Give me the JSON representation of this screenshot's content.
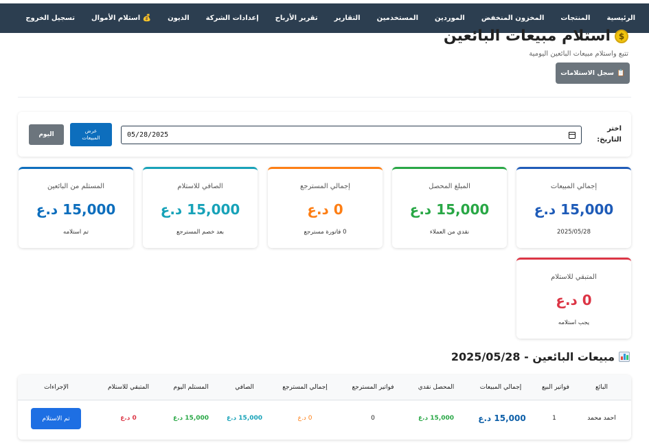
{
  "nav": {
    "items": [
      "الرئيسية",
      "المنتجات",
      "المخزون المنخفض",
      "الموردين",
      "المستخدمين",
      "التقارير",
      "تقرير الأرباح",
      "إعدادات الشركة",
      "الديون",
      "💰 استلام الأموال",
      "تسجيل الخروج"
    ]
  },
  "header": {
    "title": "استلام مبيعات البائعين",
    "subtitle": "تتبع واستلام مبيعات البائعين اليومية",
    "log_button": "سجل الاستلامات"
  },
  "filter": {
    "label_line1": "اختر",
    "label_line2": "التاريخ:",
    "date_value": "05/28/2025",
    "show_button_line1": "عرض",
    "show_button_line2": "المبيعات",
    "today_button": "اليوم"
  },
  "stats": [
    {
      "label": "إجمالي المبيعات",
      "value": "15,000 د.ع",
      "sub": "2025/05/28",
      "color": "#1e5bb8"
    },
    {
      "label": "المبلغ المحصل",
      "value": "15,000 د.ع",
      "sub": "نقدي من العملاء",
      "color": "#28a745"
    },
    {
      "label": "إجمالي المسترجع",
      "value": "0 د.ع",
      "sub": "0 فاتورة مسترجع",
      "color": "#fd7e14"
    },
    {
      "label": "الصافي للاستلام",
      "value": "15,000 د.ع",
      "sub": "بعد خصم المسترجع",
      "color": "#17a2b8"
    },
    {
      "label": "المستلم من البائعين",
      "value": "15,000 د.ع",
      "sub": "تم استلامه",
      "color": "#0d6ebd"
    },
    {
      "label": "المتبقي للاستلام",
      "value": "0 د.ع",
      "sub": "يجب استلامه",
      "color": "#dc3545"
    }
  ],
  "section": {
    "title": "مبيعات البائعين - 2025/05/28"
  },
  "table": {
    "headers": [
      "البائع",
      "فواتير البيع",
      "إجمالي المبيعات",
      "المحصل نقدي",
      "فواتير المسترجع",
      "إجمالي المسترجع",
      "الصافي",
      "المستلم اليوم",
      "المتبقي للاستلام",
      "الإجراءات"
    ],
    "row": {
      "seller": "احمد محمد",
      "invoices": "1",
      "total_sales": "15,000 د.ع",
      "cash": "15,000 د.ع",
      "return_invoices": "0",
      "total_returns": "0 د.ع",
      "net": "15,000 د.ع",
      "received_today": "15,000 د.ع",
      "remaining": "0 د.ع",
      "action": "تم الاستلام"
    }
  },
  "colors": {
    "navbar": "#2c3e50",
    "blue": "#1e5bb8",
    "green": "#28a745",
    "orange": "#fd7e14",
    "teal": "#17a2b8",
    "red": "#dc3545",
    "gray_button": "#6c757d"
  }
}
